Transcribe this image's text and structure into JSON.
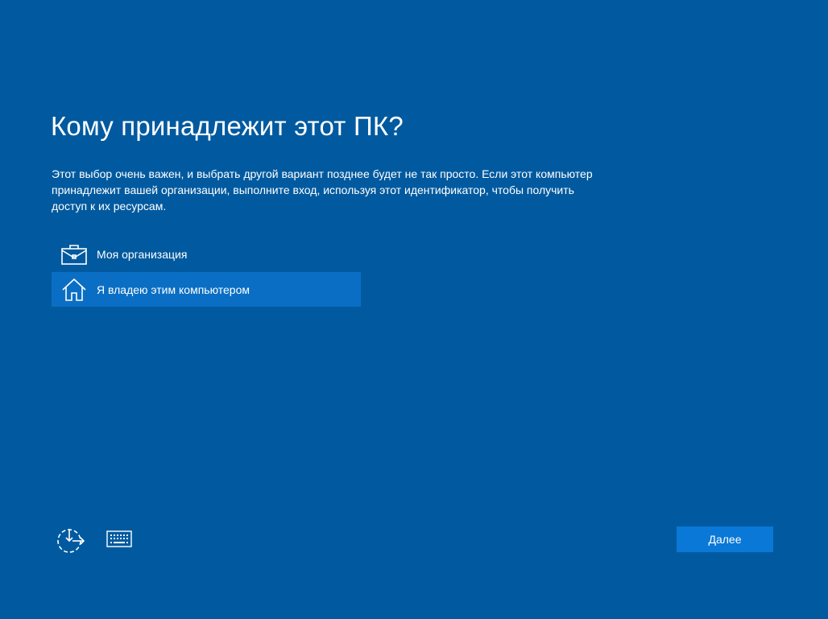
{
  "page": {
    "title": "Кому принадлежит этот ПК?",
    "description": "Этот выбор очень важен, и выбрать другой вариант позднее будет не так просто. Если этот компьютер принадлежит вашей организации, выполните вход, используя этот идентификатор, чтобы получить доступ к их ресурсам."
  },
  "options": [
    {
      "label": "Моя организация",
      "icon": "briefcase-icon",
      "selected": false
    },
    {
      "label": "Я владею этим компьютером",
      "icon": "home-icon",
      "selected": true
    }
  ],
  "footer": {
    "accessibility_icon": "ease-of-access-icon",
    "keyboard_icon": "keyboard-icon",
    "next_label": "Далее"
  },
  "colors": {
    "background": "#015a9f",
    "selected_option": "#0a6fc4",
    "button": "#0a78d7",
    "text": "#ffffff"
  }
}
